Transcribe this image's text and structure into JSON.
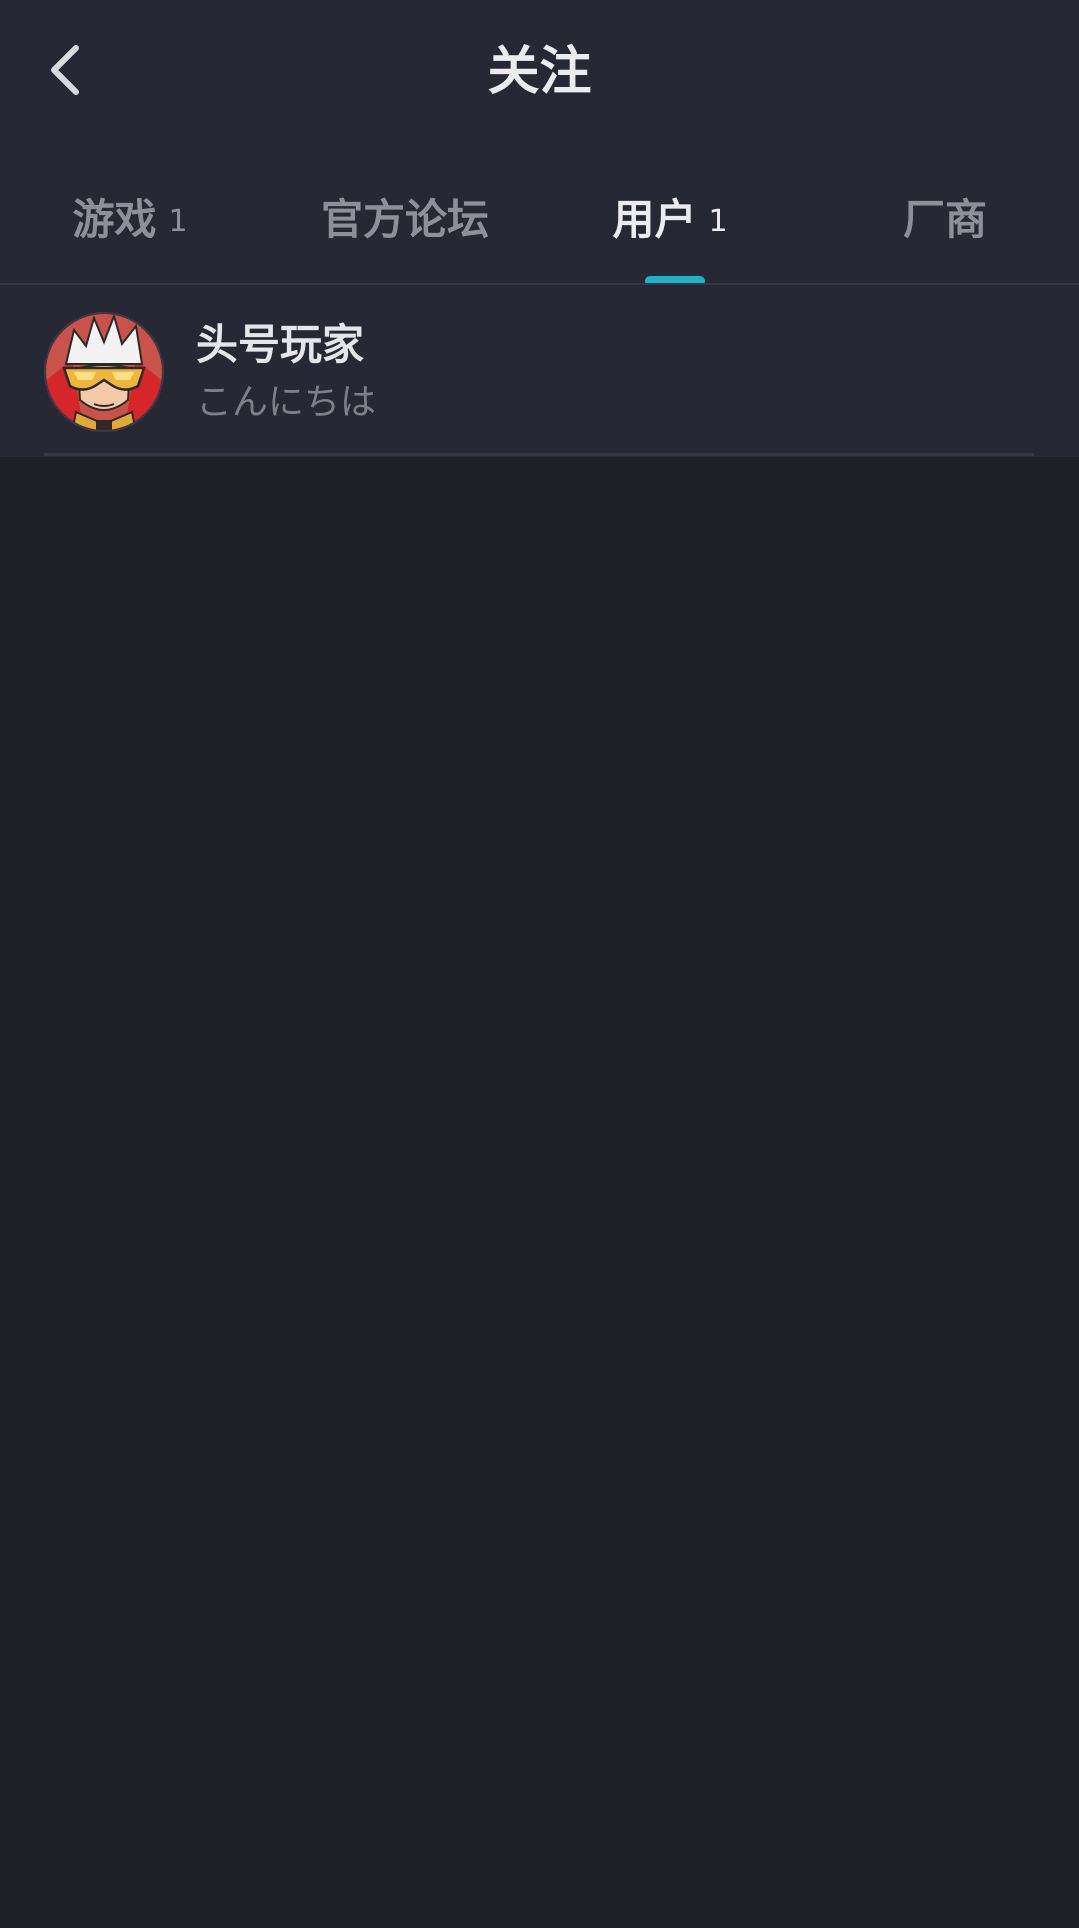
{
  "header": {
    "title": "关注",
    "back_icon": "chevron-left-icon"
  },
  "tabs": [
    {
      "label": "游戏",
      "count": "1",
      "active": false
    },
    {
      "label": "官方论坛",
      "count": "",
      "active": false
    },
    {
      "label": "用户",
      "count": "1",
      "active": true
    },
    {
      "label": "厂商",
      "count": "",
      "active": false
    }
  ],
  "colors": {
    "background": "#1f1f28",
    "header_background": "#262833",
    "accent": "#1ab3c7",
    "text_primary": "#ececf0",
    "text_secondary": "#8e9099"
  },
  "users": [
    {
      "name": "头号玩家",
      "bio": "こんにちは",
      "avatar_icon": "avatar-icon"
    }
  ]
}
